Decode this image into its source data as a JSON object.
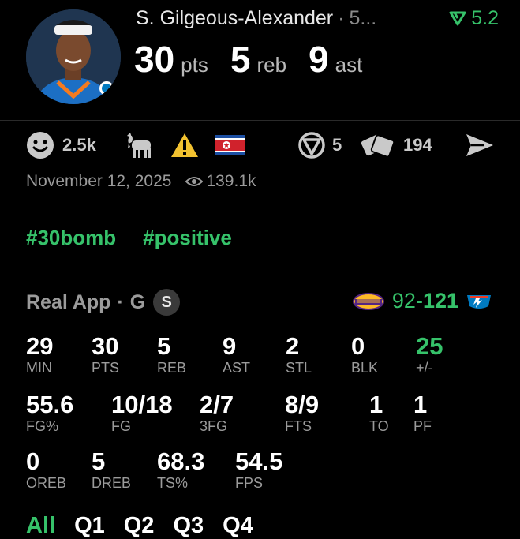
{
  "player": {
    "name": "S. Gilgeous-Alexander",
    "separator": "·",
    "truncated": "5...",
    "trend_value": "5.2"
  },
  "statline": {
    "pts_value": "30",
    "pts_unit": "pts",
    "reb_value": "5",
    "reb_unit": "reb",
    "ast_value": "9",
    "ast_unit": "ast"
  },
  "actions": {
    "reactions_count": "2.5k",
    "v_count": "5",
    "cards_count": "194"
  },
  "meta": {
    "date": "November 12, 2025",
    "views": "139.1k"
  },
  "tags": [
    "#30bomb",
    "#positive"
  ],
  "source": {
    "app": "Real App",
    "separator": "·",
    "position": "G",
    "badge": "S"
  },
  "score": {
    "away": "92",
    "dash": "-",
    "home": "121"
  },
  "stats": {
    "row1": [
      {
        "value": "29",
        "label": "MIN"
      },
      {
        "value": "30",
        "label": "PTS"
      },
      {
        "value": "5",
        "label": "REB"
      },
      {
        "value": "9",
        "label": "AST"
      },
      {
        "value": "2",
        "label": "STL"
      },
      {
        "value": "0",
        "label": "BLK"
      },
      {
        "value": "25",
        "label": "+/-"
      }
    ],
    "row2": [
      {
        "value": "55.6",
        "label": "FG%"
      },
      {
        "value": "10/18",
        "label": "FG"
      },
      {
        "value": "2/7",
        "label": "3FG"
      },
      {
        "value": "8/9",
        "label": "FTS"
      },
      {
        "value": "1",
        "label": "TO"
      },
      {
        "value": "1",
        "label": "PF"
      }
    ],
    "row3": [
      {
        "value": "0",
        "label": "OREB"
      },
      {
        "value": "5",
        "label": "DREB"
      },
      {
        "value": "68.3",
        "label": "TS%"
      },
      {
        "value": "54.5",
        "label": "FPS"
      }
    ]
  },
  "quarters": [
    "All",
    "Q1",
    "Q2",
    "Q3",
    "Q4"
  ],
  "colors": {
    "accent_green": "#36c26a",
    "muted_gray": "#9b9b9b",
    "warning_yellow": "#f2c230"
  },
  "icons": [
    "smiley-icon",
    "goat-icon",
    "warning-icon",
    "flag-icon",
    "v-logo-icon",
    "cards-icon",
    "send-icon",
    "eye-icon",
    "trend-up-icon"
  ]
}
